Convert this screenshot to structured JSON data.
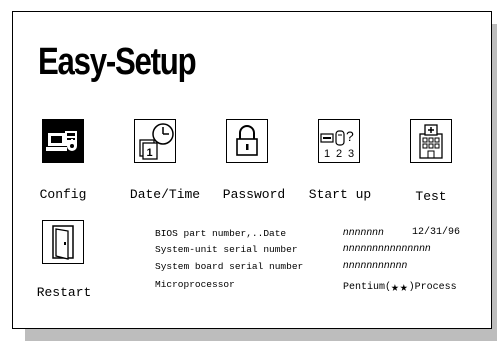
{
  "title": "Easy-Setup",
  "menu": [
    {
      "label": "Config",
      "icon": "computer-config-icon",
      "selected": true
    },
    {
      "label": "Date/Time",
      "icon": "calendar-clock-icon",
      "selected": false
    },
    {
      "label": "Password",
      "icon": "padlock-icon",
      "selected": false
    },
    {
      "label": "Start up",
      "icon": "startup-devices-icon",
      "selected": false
    },
    {
      "label": "Test",
      "icon": "hospital-test-icon",
      "selected": false
    },
    {
      "label": "Restart",
      "icon": "door-icon",
      "selected": false
    }
  ],
  "info": {
    "bios_label": "BIOS part number,..Date",
    "bios_number": "nnnnnnn",
    "bios_date": "12/31/96",
    "serial_label": "System-unit serial number",
    "serial_value": "nnnnnnnnnnnnnnn",
    "board_label": "System board serial number",
    "board_value": "nnnnnnnnnnn",
    "cpu_label": "Microprocessor",
    "cpu_value_prefix": "Pentium(",
    "cpu_value_stars": "★★",
    "cpu_value_suffix": ")Process"
  }
}
